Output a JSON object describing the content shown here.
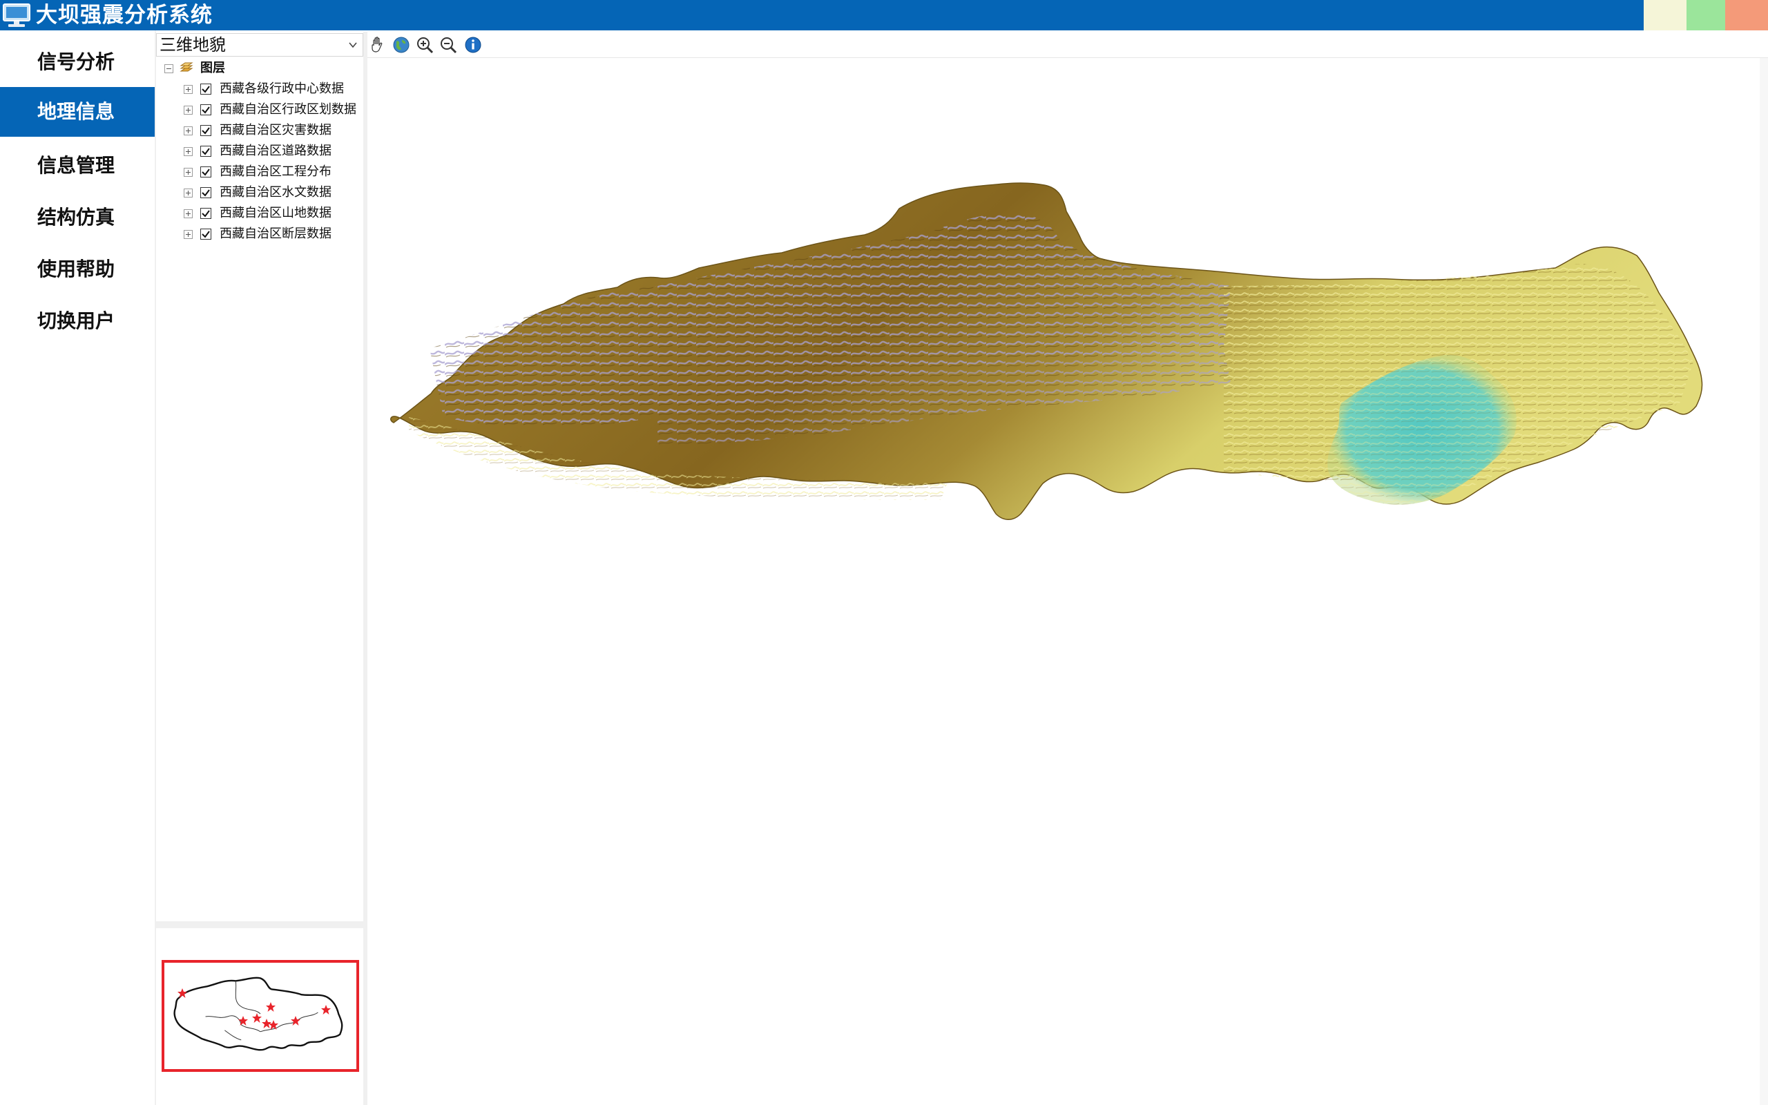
{
  "window": {
    "title": "大坝强震分析系统",
    "accent_color": "#0565b6",
    "controls": [
      {
        "name": "minimize",
        "color": "#f5f5d8"
      },
      {
        "name": "maximize",
        "color": "#9be59b"
      },
      {
        "name": "close",
        "color": "#f49a79"
      }
    ]
  },
  "nav": {
    "items": [
      {
        "label": "信号分析",
        "active": false
      },
      {
        "label": "地理信息",
        "active": true
      },
      {
        "label": "信息管理",
        "active": false
      },
      {
        "label": "结构仿真",
        "active": false
      },
      {
        "label": "使用帮助",
        "active": false
      },
      {
        "label": "切换用户",
        "active": false
      }
    ]
  },
  "layer_panel": {
    "selected_view": "三维地貌",
    "root": {
      "label": "图层",
      "icon": "layers-icon",
      "expanded": true
    },
    "layers": [
      {
        "label": "西藏各级行政中心数据",
        "checked": true
      },
      {
        "label": "西藏自治区行政区划数据",
        "checked": true
      },
      {
        "label": "西藏自治区灾害数据",
        "checked": true
      },
      {
        "label": "西藏自治区道路数据",
        "checked": true
      },
      {
        "label": "西藏自治区工程分布",
        "checked": true
      },
      {
        "label": "西藏自治区水文数据",
        "checked": true
      },
      {
        "label": "西藏自治区山地数据",
        "checked": true
      },
      {
        "label": "西藏自治区断层数据",
        "checked": true
      }
    ]
  },
  "toolbar": {
    "tools": [
      {
        "name": "pan",
        "icon": "hand-icon"
      },
      {
        "name": "full-extent",
        "icon": "globe-icon"
      },
      {
        "name": "zoom-in",
        "icon": "zoom-in-icon"
      },
      {
        "name": "zoom-out",
        "icon": "zoom-out-icon"
      },
      {
        "name": "identify",
        "icon": "info-icon"
      }
    ]
  },
  "map": {
    "terrain_colors": {
      "low": "#4fc9c3",
      "mid_low": "#d9d46a",
      "mid": "#8a6a1f",
      "high": "#a79ec8"
    }
  },
  "overview": {
    "frame_color": "#e8242b",
    "marker_color": "#e8242b",
    "marker_count": 8
  }
}
